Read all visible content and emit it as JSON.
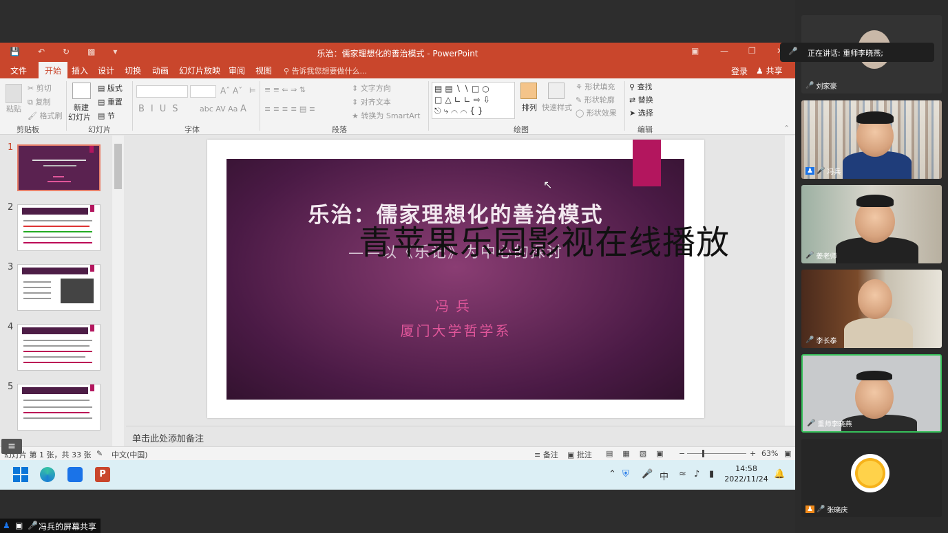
{
  "window": {
    "title": "乐治：儒家理想化的善治模式 - PowerPoint",
    "tabs": [
      "文件",
      "开始",
      "插入",
      "设计",
      "切换",
      "动画",
      "幻灯片放映",
      "审阅",
      "视图"
    ],
    "tell_me": "告诉我您想要做什么...",
    "login": "登录",
    "share": "共享"
  },
  "ribbon": {
    "clipboard": {
      "paste": "粘贴",
      "cut": "剪切",
      "copy": "复制",
      "format_painter": "格式刷",
      "group": "剪贴板"
    },
    "slides": {
      "new_slide": "新建",
      "new_slide2": "幻灯片",
      "layout": "版式",
      "reset": "重置",
      "section": "节",
      "group": "幻灯片"
    },
    "font": {
      "group": "字体"
    },
    "paragraph": {
      "text_direction": "文字方向",
      "align_text": "对齐文本",
      "smartart": "转换为 SmartArt",
      "group": "段落"
    },
    "drawing": {
      "arrange": "排列",
      "quick_styles": "快速样式",
      "shape_fill": "形状填充",
      "shape_outline": "形状轮廓",
      "shape_effects": "形状效果",
      "group": "绘图"
    },
    "editing": {
      "find": "查找",
      "replace": "替换",
      "select": "选择",
      "group": "编辑"
    }
  },
  "thumbnails": [
    {
      "num": "1",
      "selected": true
    },
    {
      "num": "2",
      "selected": false
    },
    {
      "num": "3",
      "selected": false
    },
    {
      "num": "4",
      "selected": false
    },
    {
      "num": "5",
      "selected": false
    }
  ],
  "slide": {
    "title": "乐治：儒家理想化的善治模式",
    "subtitle": "——以《乐记》为中心的探讨",
    "author": "冯兵",
    "affiliation": "厦门大学哲学系",
    "watermark": "青苹果乐园影视在线播放",
    "accent_color": "#b3165e"
  },
  "notes": {
    "placeholder": "单击此处添加备注"
  },
  "status": {
    "slide_info": "幻灯片 第 1 张，共 33 张",
    "language": "中文(中国)",
    "notes": "备注",
    "comments": "批注",
    "zoom": "63%"
  },
  "taskbar": {
    "ime": "中",
    "time": "14:58",
    "date": "2022/11/24"
  },
  "meeting": {
    "speaking": "正在讲话: 重师李晓燕;",
    "participants": [
      {
        "name": "刘家豪"
      },
      {
        "name": "冯兵"
      },
      {
        "name": "姜老师"
      },
      {
        "name": "李长泰"
      },
      {
        "name": "重师李晓燕",
        "active": true
      },
      {
        "name": "张晓庆"
      }
    ],
    "screen_share_label": "冯兵的屏幕共享"
  }
}
